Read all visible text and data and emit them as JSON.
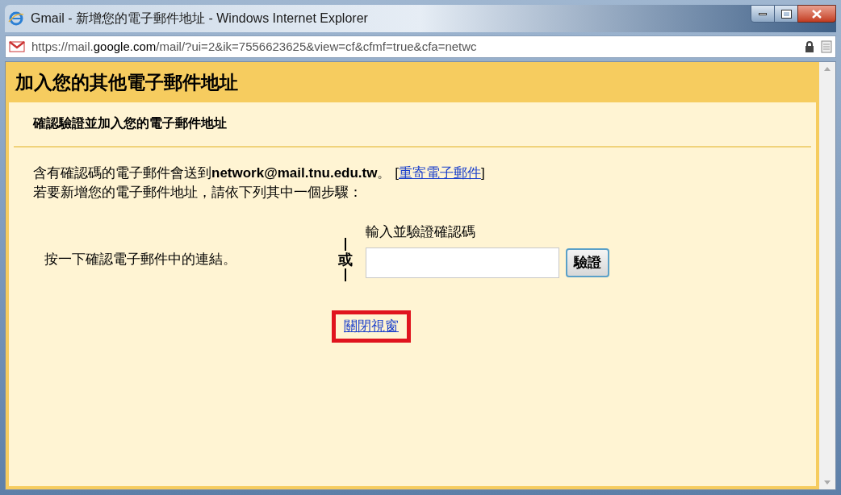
{
  "window": {
    "title": "Gmail - 新增您的電子郵件地址 - Windows Internet Explorer"
  },
  "address_bar": {
    "url_start": "https://mail.",
    "url_domain": "google.com",
    "url_rest": "/mail/?ui=2&ik=7556623625&view=cf&cfmf=true&cfa=netwc"
  },
  "dialog": {
    "title": "加入您的其他電子郵件地址",
    "subtitle": "確認驗證並加入您的電子郵件地址",
    "message": "含有確認碼的電子郵件會送到**network@mail.tnu.edu.tw**。",
    "bracket_open": "[",
    "resend_link": "重寄電子郵件",
    "bracket_close": "]",
    "instructions": "若要新增您的電子郵件地址，請依下列其中一個步驟：",
    "option_click": "按一下確認電子郵件中的連結。",
    "or_label": "或",
    "code_label": "輸入並驗證確認碼",
    "verify_button": "驗證",
    "close_link": {
      "text": "關閉視窗",
      "highlighted": true
    }
  }
}
